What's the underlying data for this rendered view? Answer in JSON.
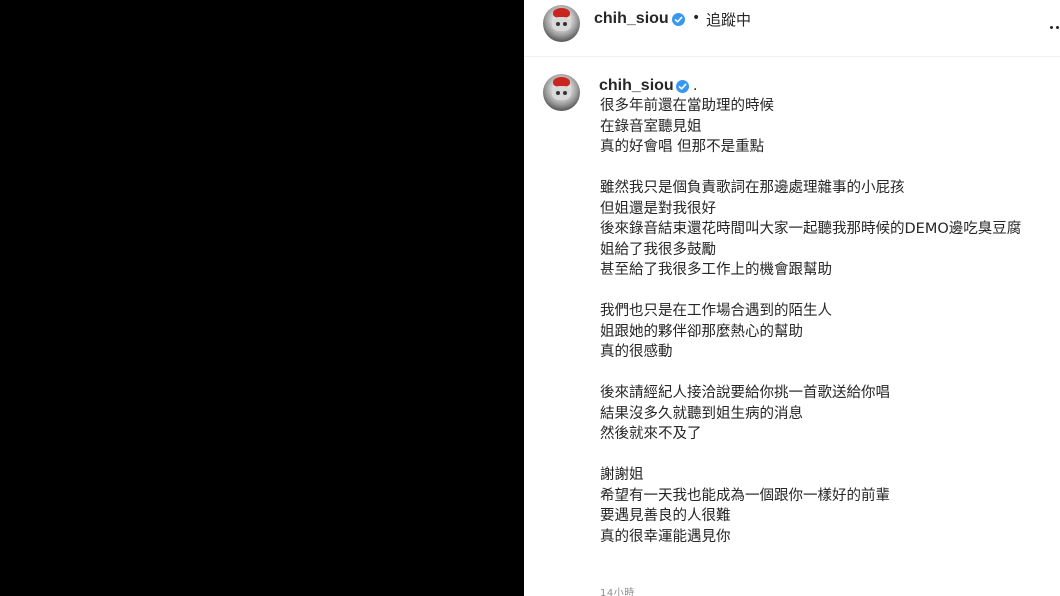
{
  "header": {
    "username": "chih_siou",
    "separator": "•",
    "follow_status": "追蹤中"
  },
  "post": {
    "username": "chih_siou",
    "after_badge": ".",
    "caption_lines": [
      "很多年前還在當助理的時候",
      "在錄音室聽見姐",
      "真的好會唱 但那不是重點",
      "",
      "雖然我只是個負責歌詞在那邊處理雜事的小屁孩",
      "但姐還是對我很好",
      "後來錄音結束還花時間叫大家一起聽我那時候的DEMO邊吃臭豆腐",
      "姐給了我很多鼓勵",
      "甚至給了我很多工作上的機會跟幫助",
      "",
      "我們也只是在工作場合遇到的陌生人",
      "姐跟她的夥伴卻那麼熱心的幫助",
      "真的很感動",
      "",
      "後來請經紀人接洽說要給你挑一首歌送給你唱",
      "結果沒多久就聽到姐生病的消息",
      "然後就來不及了",
      "",
      "謝謝姐",
      "希望有一天我也能成為一個跟你一樣好的前輩",
      "要遇見善良的人很難",
      "真的很幸運能遇見你"
    ],
    "timestamp": "14小時"
  },
  "colors": {
    "text": "#262626",
    "secondary": "#8e8e8e",
    "verified": "#3897f0",
    "media_bg": "#000000"
  },
  "icons": [
    "avatar",
    "verified-badge-icon",
    "more-options-icon"
  ]
}
